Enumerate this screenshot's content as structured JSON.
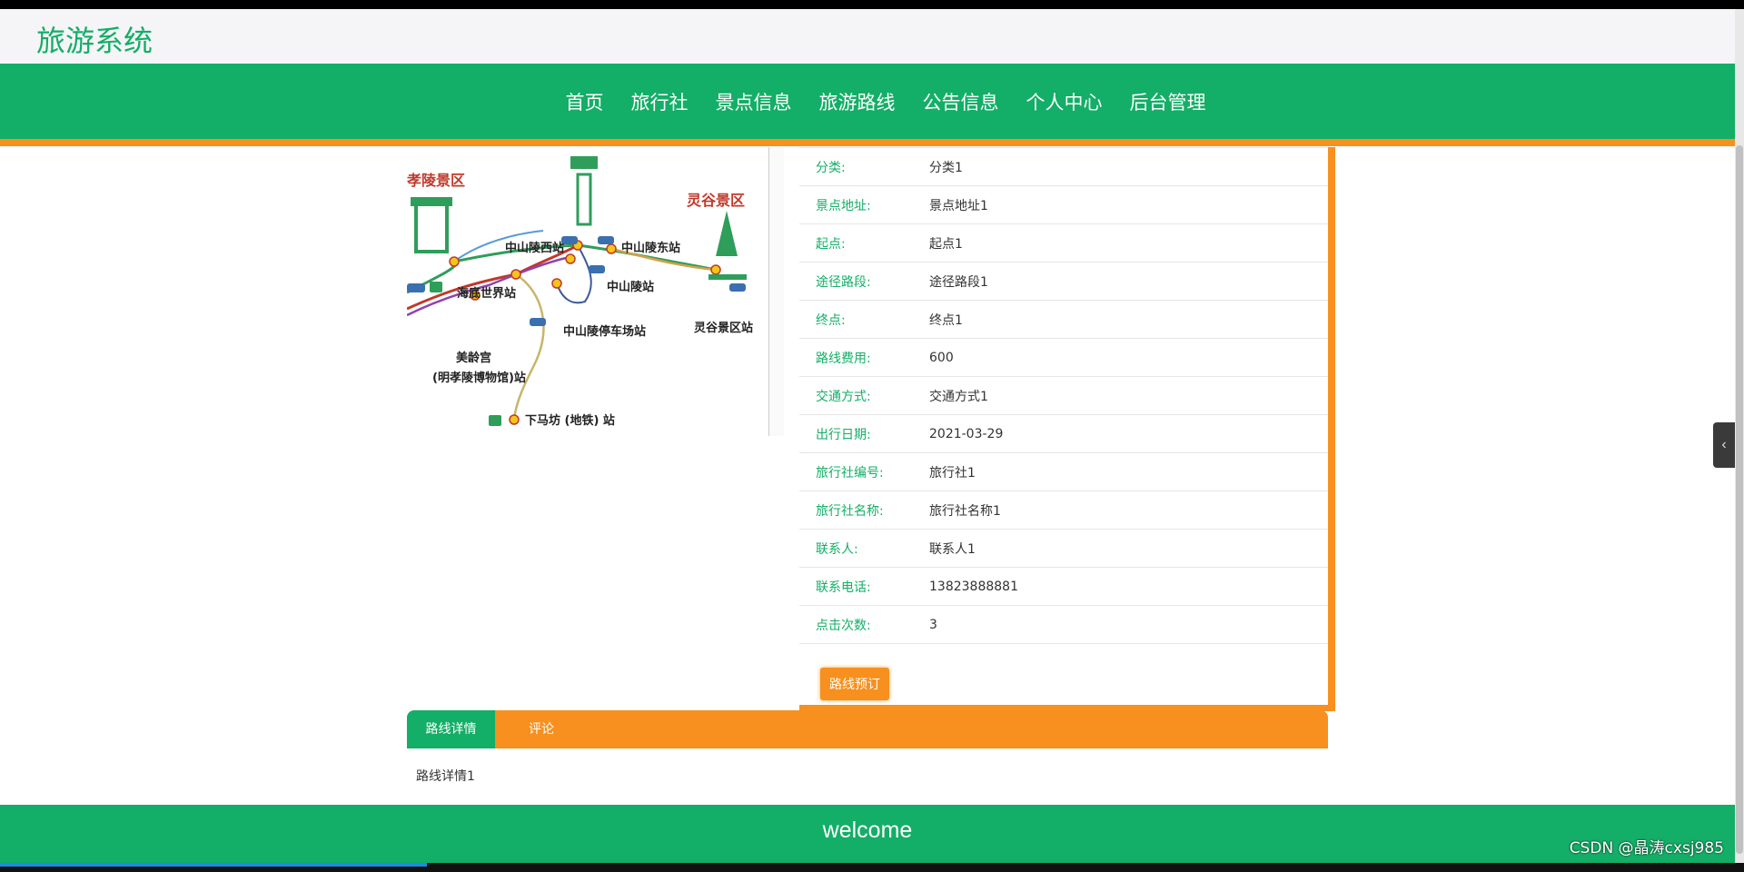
{
  "header": {
    "title": "旅游系统"
  },
  "nav": {
    "items": [
      {
        "label": "首页"
      },
      {
        "label": "旅行社"
      },
      {
        "label": "景点信息"
      },
      {
        "label": "旅游路线"
      },
      {
        "label": "公告信息"
      },
      {
        "label": "个人中心"
      },
      {
        "label": "后台管理"
      }
    ]
  },
  "map": {
    "labels": {
      "xiaoling": "孝陵景区",
      "linggu": "灵谷景区",
      "zsl_west": "中山陵西站",
      "zsl_east": "中山陵东站",
      "zsl": "中山陵站",
      "haidi": "海底世界站",
      "parking": "中山陵停车场站",
      "linggu_station": "灵谷景区站",
      "meiling": "美龄宫",
      "meiling_sub": "(明孝陵博物馆)站",
      "xiamafang": "下马坊 (地铁) 站"
    }
  },
  "details": {
    "rows": [
      {
        "label": "分类:",
        "value": "分类1"
      },
      {
        "label": "景点地址:",
        "value": "景点地址1"
      },
      {
        "label": "起点:",
        "value": "起点1"
      },
      {
        "label": "途径路段:",
        "value": "途径路段1"
      },
      {
        "label": "终点:",
        "value": "终点1"
      },
      {
        "label": "路线费用:",
        "value": "600"
      },
      {
        "label": "交通方式:",
        "value": "交通方式1"
      },
      {
        "label": "出行日期:",
        "value": "2021-03-29"
      },
      {
        "label": "旅行社编号:",
        "value": "旅行社1"
      },
      {
        "label": "旅行社名称:",
        "value": "旅行社名称1"
      },
      {
        "label": "联系人:",
        "value": "联系人1"
      },
      {
        "label": "联系电话:",
        "value": "13823888881"
      },
      {
        "label": "点击次数:",
        "value": "3"
      }
    ],
    "book_label": "路线预订"
  },
  "tabs": {
    "items": [
      {
        "label": "路线详情"
      },
      {
        "label": "评论"
      }
    ],
    "content": "路线详情1"
  },
  "footer": {
    "text": "welcome"
  },
  "watermark": "CSDN @晶涛cxsj985",
  "colors": {
    "green": "#13ae67",
    "orange": "#f7901e"
  }
}
